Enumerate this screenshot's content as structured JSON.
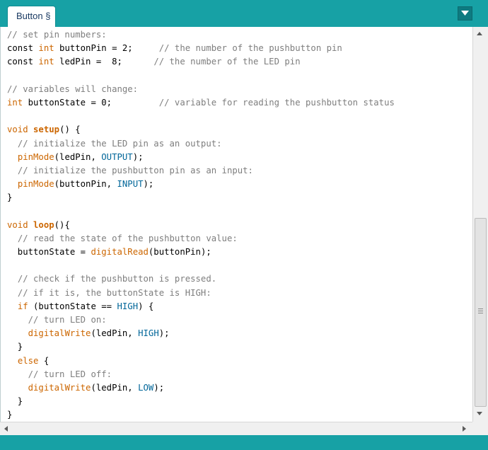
{
  "tab": {
    "label": "Button §"
  },
  "colors": {
    "bar": "#17a1a5",
    "keyword": "#cc6600",
    "constant": "#006699",
    "comment": "#7e7e7e"
  },
  "icons": {
    "tab_menu": "chevron-down-icon"
  },
  "code_lines": [
    [
      {
        "t": "// set pin numbers:",
        "c": "c"
      }
    ],
    [
      {
        "t": "const ",
        "c": ""
      },
      {
        "t": "int",
        "c": "k"
      },
      {
        "t": " buttonPin = 2;     ",
        "c": ""
      },
      {
        "t": "// the number of the pushbutton pin",
        "c": "c"
      }
    ],
    [
      {
        "t": "const ",
        "c": ""
      },
      {
        "t": "int",
        "c": "k"
      },
      {
        "t": " ledPin =  8;      ",
        "c": ""
      },
      {
        "t": "// the number of the LED pin",
        "c": "c"
      }
    ],
    [],
    [
      {
        "t": "// variables will change:",
        "c": "c"
      }
    ],
    [
      {
        "t": "int",
        "c": "k"
      },
      {
        "t": " buttonState = 0;         ",
        "c": ""
      },
      {
        "t": "// variable for reading the pushbutton status",
        "c": "c"
      }
    ],
    [],
    [
      {
        "t": "void",
        "c": "k"
      },
      {
        "t": " ",
        "c": ""
      },
      {
        "t": "setup",
        "c": "kb"
      },
      {
        "t": "() {",
        "c": ""
      }
    ],
    [
      {
        "t": "  ",
        "c": ""
      },
      {
        "t": "// initialize the LED pin as an output:",
        "c": "c"
      }
    ],
    [
      {
        "t": "  ",
        "c": ""
      },
      {
        "t": "pinMode",
        "c": "k"
      },
      {
        "t": "(ledPin, ",
        "c": ""
      },
      {
        "t": "OUTPUT",
        "c": "cn"
      },
      {
        "t": ");",
        "c": ""
      }
    ],
    [
      {
        "t": "  ",
        "c": ""
      },
      {
        "t": "// initialize the pushbutton pin as an input:",
        "c": "c"
      }
    ],
    [
      {
        "t": "  ",
        "c": ""
      },
      {
        "t": "pinMode",
        "c": "k"
      },
      {
        "t": "(buttonPin, ",
        "c": ""
      },
      {
        "t": "INPUT",
        "c": "cn"
      },
      {
        "t": ");",
        "c": ""
      }
    ],
    [
      {
        "t": "}",
        "c": ""
      }
    ],
    [],
    [
      {
        "t": "void",
        "c": "k"
      },
      {
        "t": " ",
        "c": ""
      },
      {
        "t": "loop",
        "c": "kb"
      },
      {
        "t": "(){",
        "c": ""
      }
    ],
    [
      {
        "t": "  ",
        "c": ""
      },
      {
        "t": "// read the state of the pushbutton value:",
        "c": "c"
      }
    ],
    [
      {
        "t": "  buttonState = ",
        "c": ""
      },
      {
        "t": "digitalRead",
        "c": "k"
      },
      {
        "t": "(buttonPin);",
        "c": ""
      }
    ],
    [],
    [
      {
        "t": "  ",
        "c": ""
      },
      {
        "t": "// check if the pushbutton is pressed.",
        "c": "c"
      }
    ],
    [
      {
        "t": "  ",
        "c": ""
      },
      {
        "t": "// if it is, the buttonState is HIGH:",
        "c": "c"
      }
    ],
    [
      {
        "t": "  ",
        "c": ""
      },
      {
        "t": "if",
        "c": "k"
      },
      {
        "t": " (buttonState == ",
        "c": ""
      },
      {
        "t": "HIGH",
        "c": "cn"
      },
      {
        "t": ") {",
        "c": ""
      }
    ],
    [
      {
        "t": "    ",
        "c": ""
      },
      {
        "t": "// turn LED on:",
        "c": "c"
      }
    ],
    [
      {
        "t": "    ",
        "c": ""
      },
      {
        "t": "digitalWrite",
        "c": "k"
      },
      {
        "t": "(ledPin, ",
        "c": ""
      },
      {
        "t": "HIGH",
        "c": "cn"
      },
      {
        "t": ");",
        "c": ""
      }
    ],
    [
      {
        "t": "  }",
        "c": ""
      }
    ],
    [
      {
        "t": "  ",
        "c": ""
      },
      {
        "t": "else",
        "c": "k"
      },
      {
        "t": " {",
        "c": ""
      }
    ],
    [
      {
        "t": "    ",
        "c": ""
      },
      {
        "t": "// turn LED off:",
        "c": "c"
      }
    ],
    [
      {
        "t": "    ",
        "c": ""
      },
      {
        "t": "digitalWrite",
        "c": "k"
      },
      {
        "t": "(ledPin, ",
        "c": ""
      },
      {
        "t": "LOW",
        "c": "cn"
      },
      {
        "t": ");",
        "c": ""
      }
    ],
    [
      {
        "t": "  }",
        "c": ""
      }
    ],
    [
      {
        "t": "}",
        "c": ""
      }
    ]
  ]
}
